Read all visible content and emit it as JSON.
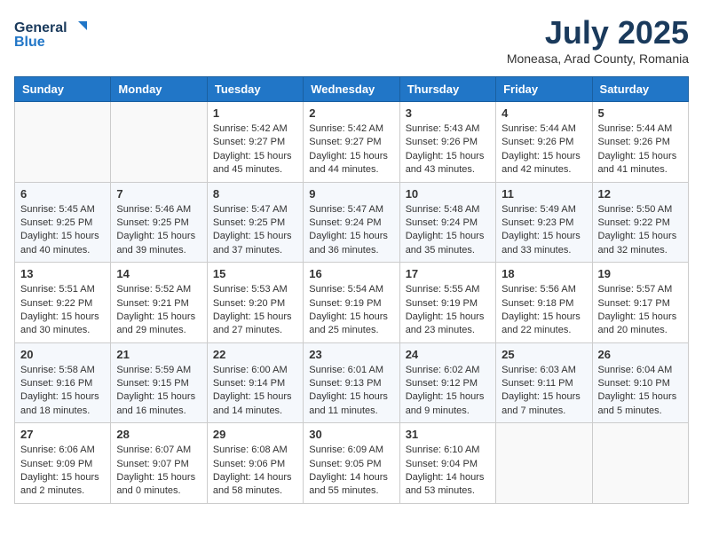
{
  "logo": {
    "general": "General",
    "blue": "Blue"
  },
  "title": "July 2025",
  "location": "Moneasa, Arad County, Romania",
  "days_header": [
    "Sunday",
    "Monday",
    "Tuesday",
    "Wednesday",
    "Thursday",
    "Friday",
    "Saturday"
  ],
  "weeks": [
    [
      {
        "day": "",
        "content": ""
      },
      {
        "day": "",
        "content": ""
      },
      {
        "day": "1",
        "sunrise": "Sunrise: 5:42 AM",
        "sunset": "Sunset: 9:27 PM",
        "daylight": "Daylight: 15 hours and 45 minutes."
      },
      {
        "day": "2",
        "sunrise": "Sunrise: 5:42 AM",
        "sunset": "Sunset: 9:27 PM",
        "daylight": "Daylight: 15 hours and 44 minutes."
      },
      {
        "day": "3",
        "sunrise": "Sunrise: 5:43 AM",
        "sunset": "Sunset: 9:26 PM",
        "daylight": "Daylight: 15 hours and 43 minutes."
      },
      {
        "day": "4",
        "sunrise": "Sunrise: 5:44 AM",
        "sunset": "Sunset: 9:26 PM",
        "daylight": "Daylight: 15 hours and 42 minutes."
      },
      {
        "day": "5",
        "sunrise": "Sunrise: 5:44 AM",
        "sunset": "Sunset: 9:26 PM",
        "daylight": "Daylight: 15 hours and 41 minutes."
      }
    ],
    [
      {
        "day": "6",
        "sunrise": "Sunrise: 5:45 AM",
        "sunset": "Sunset: 9:25 PM",
        "daylight": "Daylight: 15 hours and 40 minutes."
      },
      {
        "day": "7",
        "sunrise": "Sunrise: 5:46 AM",
        "sunset": "Sunset: 9:25 PM",
        "daylight": "Daylight: 15 hours and 39 minutes."
      },
      {
        "day": "8",
        "sunrise": "Sunrise: 5:47 AM",
        "sunset": "Sunset: 9:25 PM",
        "daylight": "Daylight: 15 hours and 37 minutes."
      },
      {
        "day": "9",
        "sunrise": "Sunrise: 5:47 AM",
        "sunset": "Sunset: 9:24 PM",
        "daylight": "Daylight: 15 hours and 36 minutes."
      },
      {
        "day": "10",
        "sunrise": "Sunrise: 5:48 AM",
        "sunset": "Sunset: 9:24 PM",
        "daylight": "Daylight: 15 hours and 35 minutes."
      },
      {
        "day": "11",
        "sunrise": "Sunrise: 5:49 AM",
        "sunset": "Sunset: 9:23 PM",
        "daylight": "Daylight: 15 hours and 33 minutes."
      },
      {
        "day": "12",
        "sunrise": "Sunrise: 5:50 AM",
        "sunset": "Sunset: 9:22 PM",
        "daylight": "Daylight: 15 hours and 32 minutes."
      }
    ],
    [
      {
        "day": "13",
        "sunrise": "Sunrise: 5:51 AM",
        "sunset": "Sunset: 9:22 PM",
        "daylight": "Daylight: 15 hours and 30 minutes."
      },
      {
        "day": "14",
        "sunrise": "Sunrise: 5:52 AM",
        "sunset": "Sunset: 9:21 PM",
        "daylight": "Daylight: 15 hours and 29 minutes."
      },
      {
        "day": "15",
        "sunrise": "Sunrise: 5:53 AM",
        "sunset": "Sunset: 9:20 PM",
        "daylight": "Daylight: 15 hours and 27 minutes."
      },
      {
        "day": "16",
        "sunrise": "Sunrise: 5:54 AM",
        "sunset": "Sunset: 9:19 PM",
        "daylight": "Daylight: 15 hours and 25 minutes."
      },
      {
        "day": "17",
        "sunrise": "Sunrise: 5:55 AM",
        "sunset": "Sunset: 9:19 PM",
        "daylight": "Daylight: 15 hours and 23 minutes."
      },
      {
        "day": "18",
        "sunrise": "Sunrise: 5:56 AM",
        "sunset": "Sunset: 9:18 PM",
        "daylight": "Daylight: 15 hours and 22 minutes."
      },
      {
        "day": "19",
        "sunrise": "Sunrise: 5:57 AM",
        "sunset": "Sunset: 9:17 PM",
        "daylight": "Daylight: 15 hours and 20 minutes."
      }
    ],
    [
      {
        "day": "20",
        "sunrise": "Sunrise: 5:58 AM",
        "sunset": "Sunset: 9:16 PM",
        "daylight": "Daylight: 15 hours and 18 minutes."
      },
      {
        "day": "21",
        "sunrise": "Sunrise: 5:59 AM",
        "sunset": "Sunset: 9:15 PM",
        "daylight": "Daylight: 15 hours and 16 minutes."
      },
      {
        "day": "22",
        "sunrise": "Sunrise: 6:00 AM",
        "sunset": "Sunset: 9:14 PM",
        "daylight": "Daylight: 15 hours and 14 minutes."
      },
      {
        "day": "23",
        "sunrise": "Sunrise: 6:01 AM",
        "sunset": "Sunset: 9:13 PM",
        "daylight": "Daylight: 15 hours and 11 minutes."
      },
      {
        "day": "24",
        "sunrise": "Sunrise: 6:02 AM",
        "sunset": "Sunset: 9:12 PM",
        "daylight": "Daylight: 15 hours and 9 minutes."
      },
      {
        "day": "25",
        "sunrise": "Sunrise: 6:03 AM",
        "sunset": "Sunset: 9:11 PM",
        "daylight": "Daylight: 15 hours and 7 minutes."
      },
      {
        "day": "26",
        "sunrise": "Sunrise: 6:04 AM",
        "sunset": "Sunset: 9:10 PM",
        "daylight": "Daylight: 15 hours and 5 minutes."
      }
    ],
    [
      {
        "day": "27",
        "sunrise": "Sunrise: 6:06 AM",
        "sunset": "Sunset: 9:09 PM",
        "daylight": "Daylight: 15 hours and 2 minutes."
      },
      {
        "day": "28",
        "sunrise": "Sunrise: 6:07 AM",
        "sunset": "Sunset: 9:07 PM",
        "daylight": "Daylight: 15 hours and 0 minutes."
      },
      {
        "day": "29",
        "sunrise": "Sunrise: 6:08 AM",
        "sunset": "Sunset: 9:06 PM",
        "daylight": "Daylight: 14 hours and 58 minutes."
      },
      {
        "day": "30",
        "sunrise": "Sunrise: 6:09 AM",
        "sunset": "Sunset: 9:05 PM",
        "daylight": "Daylight: 14 hours and 55 minutes."
      },
      {
        "day": "31",
        "sunrise": "Sunrise: 6:10 AM",
        "sunset": "Sunset: 9:04 PM",
        "daylight": "Daylight: 14 hours and 53 minutes."
      },
      {
        "day": "",
        "content": ""
      },
      {
        "day": "",
        "content": ""
      }
    ]
  ]
}
